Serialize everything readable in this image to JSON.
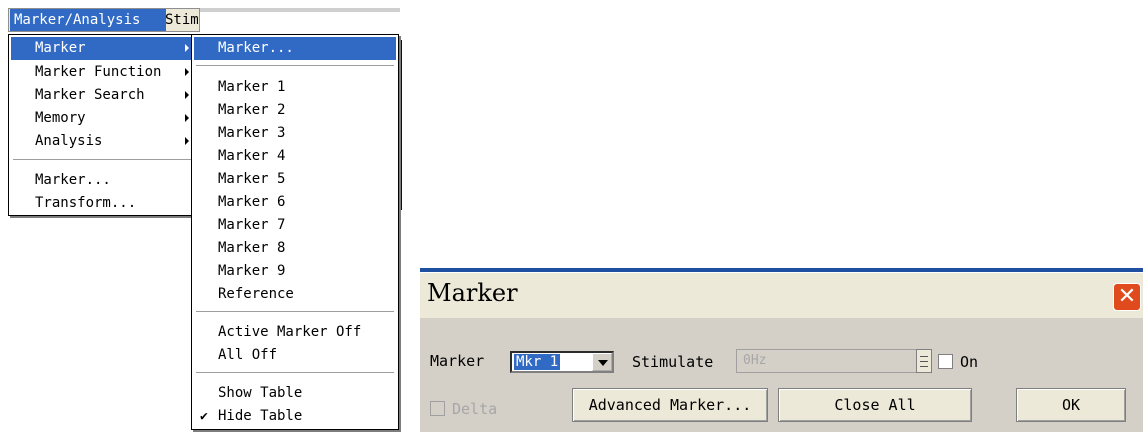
{
  "menubar": {
    "items": [
      "Marker/Analysis",
      "Stim"
    ]
  },
  "main_menu": {
    "items": [
      {
        "label": "Marker",
        "submenu": true,
        "highlighted": true
      },
      {
        "label": "Marker Function",
        "submenu": true
      },
      {
        "label": "Marker Search",
        "submenu": true
      },
      {
        "label": "Memory",
        "submenu": true
      },
      {
        "label": "Analysis",
        "submenu": true
      },
      {
        "label": "Marker...",
        "submenu": false
      },
      {
        "label": "Transform...",
        "submenu": false
      }
    ]
  },
  "submenu": {
    "items": [
      {
        "label": "Marker...",
        "highlighted": true
      },
      {
        "label": "Marker 1"
      },
      {
        "label": "Marker 2"
      },
      {
        "label": "Marker 3"
      },
      {
        "label": "Marker 4"
      },
      {
        "label": "Marker 5"
      },
      {
        "label": "Marker 6"
      },
      {
        "label": "Marker 7"
      },
      {
        "label": "Marker 8"
      },
      {
        "label": "Marker 9"
      },
      {
        "label": "Reference"
      },
      {
        "label": "Active Marker Off"
      },
      {
        "label": "All Off"
      },
      {
        "label": "Show Table"
      },
      {
        "label": "Hide Table",
        "checked": true
      }
    ],
    "check_glyph": "✔"
  },
  "dialog": {
    "title": "Marker",
    "close_glyph": "✕",
    "marker_label": "Marker",
    "marker_value": "Mkr 1",
    "stimulate_label": "Stimulate",
    "stimulate_value": "0Hz",
    "on_label": "On",
    "delta_label": "Delta",
    "advanced_button": "Advanced Marker...",
    "close_all_button": "Close All",
    "ok_button": "OK"
  },
  "colors": {
    "highlight": "#316ac5",
    "close_button": "#e04a1c",
    "dialog_face": "#d4d0c8"
  }
}
